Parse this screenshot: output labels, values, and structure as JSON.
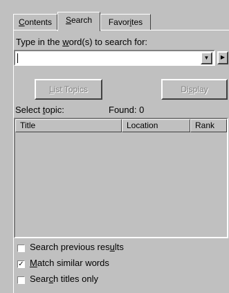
{
  "tabs": [
    {
      "before": "",
      "mnemonic": "C",
      "after": "ontents"
    },
    {
      "before": "",
      "mnemonic": "S",
      "after": "earch"
    },
    {
      "before": "Favor",
      "mnemonic": "i",
      "after": "tes"
    }
  ],
  "active_tab": "Search",
  "search": {
    "label_before": "Type in the ",
    "label_mnemonic": "w",
    "label_after": "ord(s) to search for:",
    "value": "",
    "dropdown_icon": "dropdown-arrow-icon",
    "go_icon": "right-arrow-icon"
  },
  "buttons": {
    "list_topics": {
      "mnemonic": "L",
      "after": "ist Topics",
      "enabled": false
    },
    "display": {
      "before": "Di",
      "mnemonic": "s",
      "after": "play",
      "enabled": false
    }
  },
  "select_topic": {
    "before": "Select ",
    "mnemonic": "t",
    "after": "opic:",
    "found_label": "Found:",
    "found_count": "0"
  },
  "columns": [
    "Title",
    "Location",
    "Rank"
  ],
  "rows": [],
  "options": [
    {
      "before": "Search previous res",
      "mnemonic": "u",
      "after": "lts",
      "checked": false,
      "check_mark": ""
    },
    {
      "before": "",
      "mnemonic": "M",
      "after": "atch similar words",
      "checked": true,
      "check_mark": "✓"
    },
    {
      "before": "Sear",
      "mnemonic": "c",
      "after": "h titles only",
      "checked": false,
      "check_mark": ""
    }
  ],
  "colors": {
    "face": "#c0c0c0",
    "highlight": "#ffffff",
    "shadow": "#808080",
    "dark_shadow": "#404040",
    "disabled_text": "#808080"
  }
}
